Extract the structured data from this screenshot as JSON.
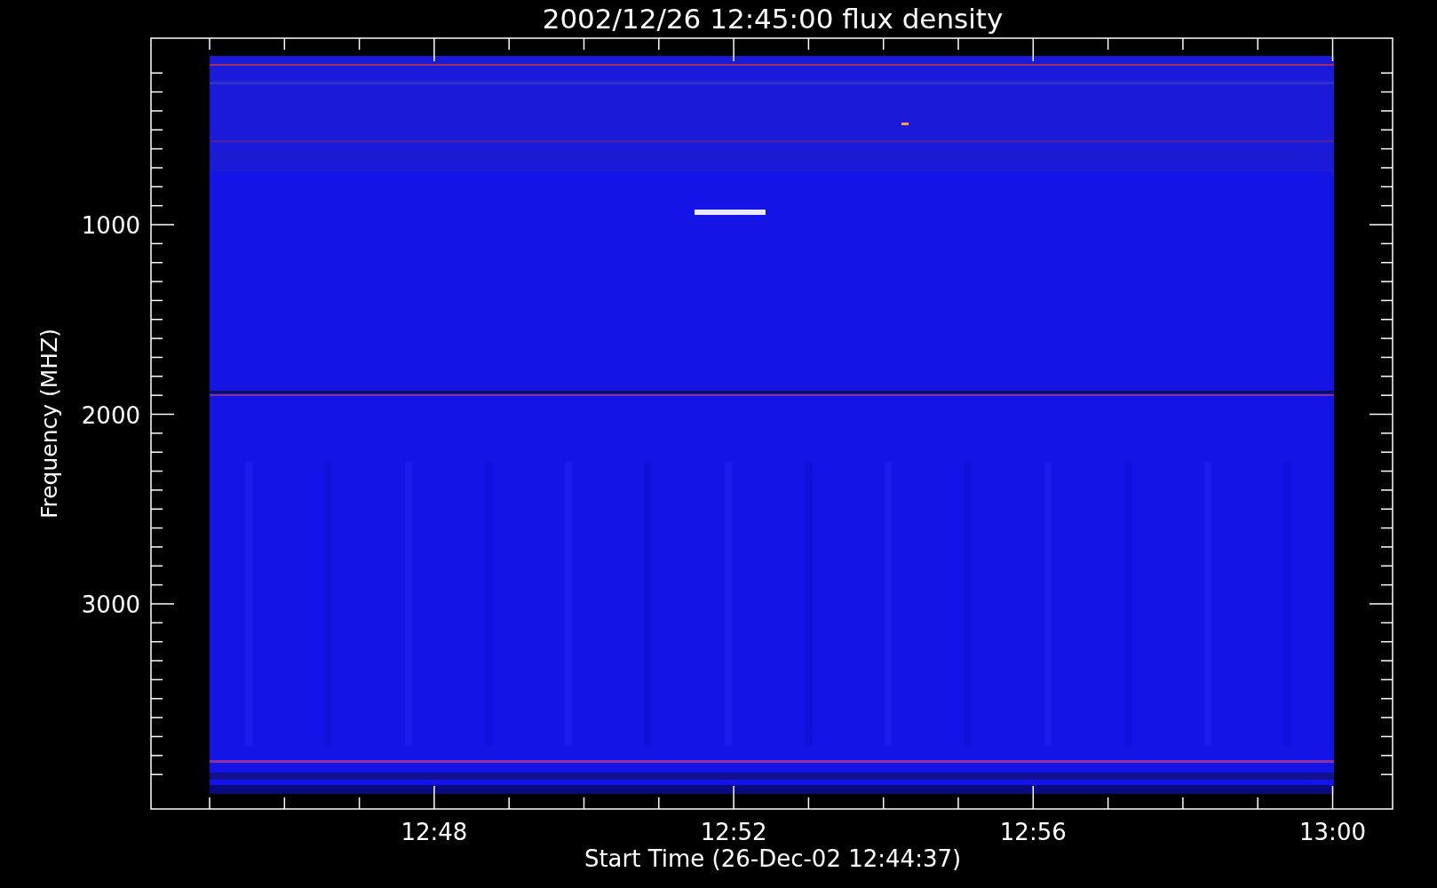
{
  "title": "2002/12/26 12:45:00 flux density",
  "y_axis": {
    "label": "Frequency (MHZ)",
    "ticks": [
      "1000",
      "2000",
      "3000"
    ]
  },
  "x_axis": {
    "label": "Start Time (26-Dec-02 12:44:37)",
    "ticks": [
      "12:48",
      "12:52",
      "12:56",
      "13:00"
    ]
  }
}
